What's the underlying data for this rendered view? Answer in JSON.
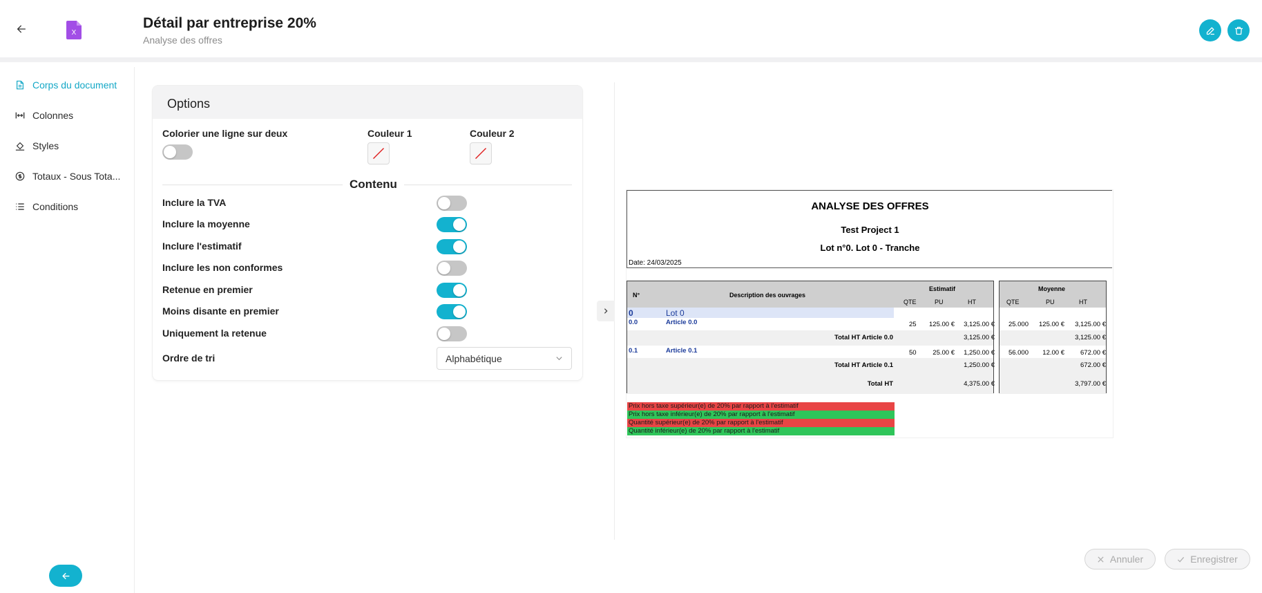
{
  "header": {
    "title": "Détail par entreprise 20%",
    "subtitle": "Analyse des offres",
    "file_icon_letter": "X"
  },
  "sidebar": {
    "items": [
      {
        "label": "Corps du document",
        "icon": "document-icon",
        "active": true
      },
      {
        "label": "Colonnes",
        "icon": "columns-icon",
        "active": false
      },
      {
        "label": "Styles",
        "icon": "paint-bucket-icon",
        "active": false
      },
      {
        "label": "Totaux - Sous Tota...",
        "icon": "dollar-circle-icon",
        "active": false
      },
      {
        "label": "Conditions",
        "icon": "list-icon",
        "active": false
      }
    ]
  },
  "options": {
    "title": "Options",
    "alternate_label": "Colorier une ligne sur deux",
    "alternate_on": false,
    "color1_label": "Couleur 1",
    "color2_label": "Couleur 2",
    "content_title": "Contenu",
    "toggles": [
      {
        "label": "Inclure la TVA",
        "on": false
      },
      {
        "label": "Inclure la moyenne",
        "on": true
      },
      {
        "label": "Inclure l'estimatif",
        "on": true
      },
      {
        "label": "Inclure les non conformes",
        "on": false
      },
      {
        "label": "Retenue en premier",
        "on": true
      },
      {
        "label": "Moins disante en premier",
        "on": true
      },
      {
        "label": "Uniquement la retenue",
        "on": false
      }
    ],
    "sort_label": "Ordre de tri",
    "sort_value": "Alphabétique"
  },
  "document": {
    "title": "ANALYSE DES OFFRES",
    "project": "Test Project 1",
    "lot_line": "Lot n°0. Lot 0 - Tranche",
    "date": "Date: 24/03/2025",
    "col_num": "N°",
    "col_desc": "Description des ouvrages",
    "estimatif_title": "Estimatif",
    "moyenne_title": "Moyenne",
    "sub_qte": "QTE",
    "sub_pu": "PU",
    "sub_ht": "HT",
    "lot_num": "0",
    "lot_name": "Lot 0",
    "articles": [
      {
        "num": "0.0",
        "name": "Article 0.0",
        "est_qte": "25",
        "est_pu": "125.00 €",
        "est_ht": "3,125.00 €",
        "moy_qte": "25.000",
        "moy_pu": "125.00 €",
        "moy_ht": "3,125.00 €",
        "total_label": "Total HT Article 0.0",
        "total_est": "3,125.00 €",
        "total_moy": "3,125.00 €"
      },
      {
        "num": "0.1",
        "name": "Article 0.1",
        "est_qte": "50",
        "est_pu": "25.00 €",
        "est_ht": "1,250.00 €",
        "moy_qte": "56.000",
        "moy_pu": "12.00 €",
        "moy_ht": "672.00 €",
        "total_label": "Total HT Article 0.1",
        "total_est": "1,250.00 €",
        "total_moy": "672.00 €"
      }
    ],
    "total_label": "Total HT",
    "total_est": "4,375.00 €",
    "total_moy": "3,797.00 €",
    "legend": [
      {
        "text": "Prix hors taxe supérieur(e) de 20% par rapport à l'estimatif",
        "color": "#e84545"
      },
      {
        "text": "Prix hors taxe inférieur(e) de 20% par rapport à l'estimatif",
        "color": "#2fc55a"
      },
      {
        "text": "Quantité supérieur(e) de 20% par rapport à l'estimatif",
        "color": "#e84545"
      },
      {
        "text": "Quantité inférieur(e) de 20% par rapport à l'estimatif",
        "color": "#2fc55a"
      }
    ]
  },
  "footer": {
    "cancel_label": "Annuler",
    "save_label": "Enregistrer"
  },
  "colors": {
    "accent": "#13b2cf",
    "file_icon": "#a24ee6"
  }
}
